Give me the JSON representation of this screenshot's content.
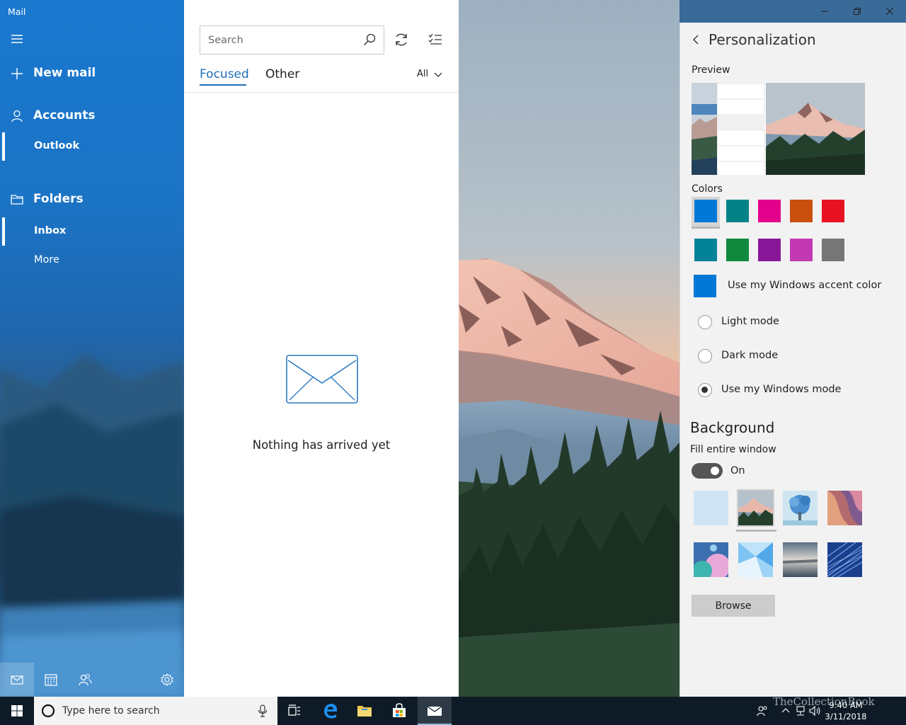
{
  "app": {
    "title": "Mail"
  },
  "sidebar": {
    "new_mail": "New mail",
    "accounts": "Accounts",
    "account_name": "Outlook",
    "folders": "Folders",
    "folder_inbox": "Inbox",
    "folder_more": "More"
  },
  "message_list": {
    "search_placeholder": "Search",
    "tabs": [
      {
        "label": "Focused",
        "active": true
      },
      {
        "label": "Other",
        "active": false
      }
    ],
    "filter": "All",
    "empty_text": "Nothing has arrived yet"
  },
  "personalization": {
    "title": "Personalization",
    "preview_label": "Preview",
    "colors_label": "Colors",
    "colors": [
      "#0078d7",
      "#038387",
      "#e3008c",
      "#ca5010",
      "#e81123",
      "#038298",
      "#10893e",
      "#881798",
      "#c239b3",
      "#767676"
    ],
    "selected_color": "#0078d7",
    "accent_color": "#0078d7",
    "use_accent_label": "Use my Windows accent color",
    "modes": [
      {
        "label": "Light mode",
        "selected": false
      },
      {
        "label": "Dark mode",
        "selected": false
      },
      {
        "label": "Use my Windows mode",
        "selected": true
      }
    ],
    "background_title": "Background",
    "fill_label": "Fill entire window",
    "fill_state": "On",
    "backgrounds": [
      "light-blue-plain",
      "mountain-forest",
      "blue-tree",
      "canyon",
      "planets",
      "blue-crystal",
      "sunset-horizon",
      "blue-streaks"
    ],
    "selected_background": "mountain-forest",
    "browse_label": "Browse"
  },
  "taskbar": {
    "search_placeholder": "Type here to search",
    "time": "9:40 AM",
    "date": "3/11/2018",
    "watermark": "TheCollectionBook"
  }
}
